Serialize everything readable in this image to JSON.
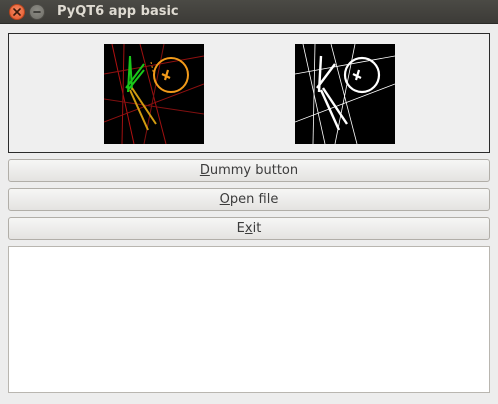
{
  "window": {
    "title": "PyQT6 app basic",
    "controls": [
      "close-icon",
      "minimize-icon"
    ]
  },
  "images": {
    "left": {
      "description_icon": "color-line-detection-image"
    },
    "right": {
      "description_icon": "binary-edge-image"
    }
  },
  "buttons": {
    "dummy": {
      "mnemonic": "D",
      "rest": "ummy button"
    },
    "open_file": {
      "mnemonic": "O",
      "rest": "pen file"
    },
    "exit": {
      "pre": "E",
      "mnemonic": "x",
      "rest": "it"
    }
  },
  "output": {
    "value": ""
  },
  "colors": {
    "titlebar": "#3c3b37",
    "close_button": "#e5562a",
    "window_bg": "#ededed"
  }
}
